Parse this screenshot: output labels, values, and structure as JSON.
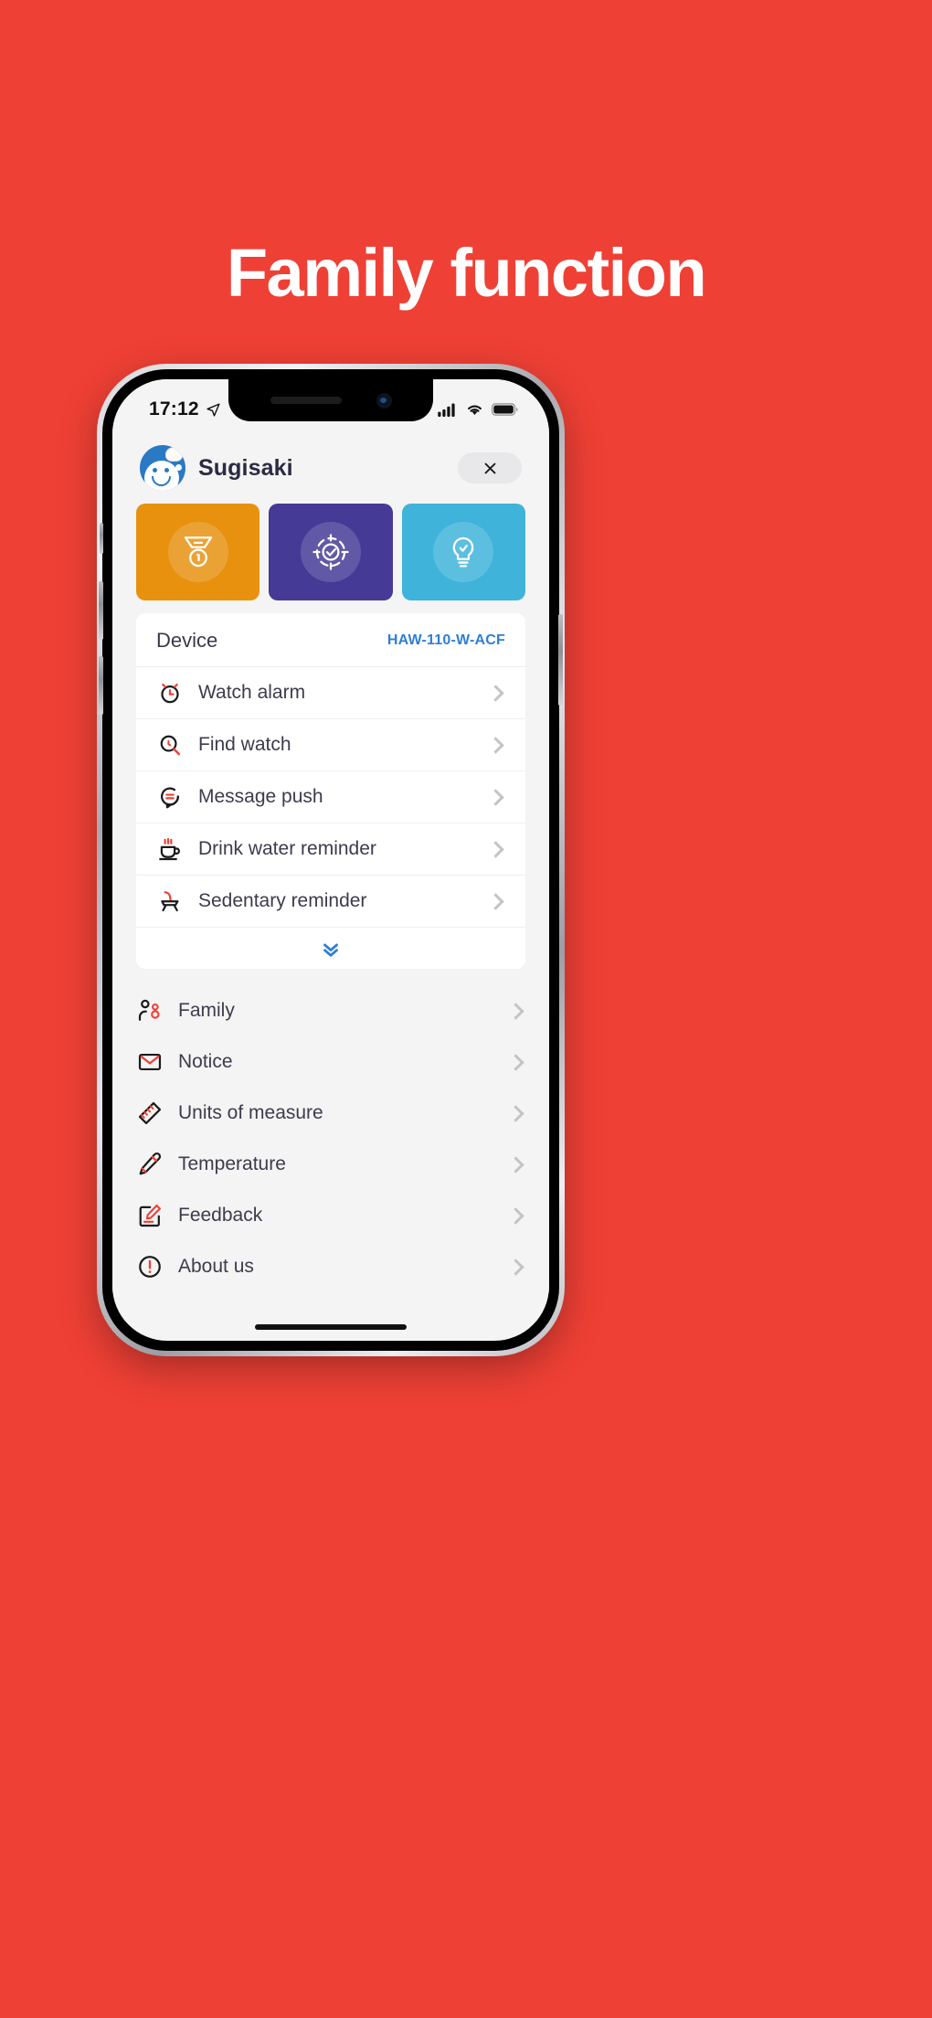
{
  "promo": {
    "headline": "Family function",
    "background_color": "#ef4035"
  },
  "status_bar": {
    "time": "17:12",
    "location_icon": "location-arrow-icon",
    "signal_icon": "cellular-signal-icon",
    "wifi_icon": "wifi-icon",
    "battery_icon": "battery-full-icon"
  },
  "header": {
    "avatar_icon": "user-avatar-icon",
    "title": "Sugisaki",
    "close_label": "close-icon"
  },
  "tiles": [
    {
      "name": "achievement",
      "icon": "medal-icon",
      "color": "#e8910f"
    },
    {
      "name": "goal",
      "icon": "target-check-icon",
      "color": "#453a96"
    },
    {
      "name": "tips",
      "icon": "lightbulb-check-icon",
      "color": "#3fb3d9"
    }
  ],
  "device_card": {
    "title": "Device",
    "value": "HAW-110-W-ACF",
    "value_color": "#2f7fd4",
    "items": [
      {
        "label": "Watch alarm",
        "icon": "alarm-clock-icon"
      },
      {
        "label": "Find watch",
        "icon": "search-watch-icon"
      },
      {
        "label": "Message push",
        "icon": "message-bubble-icon"
      },
      {
        "label": "Drink water reminder",
        "icon": "cup-icon"
      },
      {
        "label": "Sedentary reminder",
        "icon": "chair-icon"
      }
    ],
    "expand_icon": "double-chevron-down-icon"
  },
  "menu": {
    "items": [
      {
        "label": "Family",
        "icon": "family-people-icon"
      },
      {
        "label": "Notice",
        "icon": "envelope-icon"
      },
      {
        "label": "Units of measure",
        "icon": "ruler-icon"
      },
      {
        "label": "Temperature",
        "icon": "thermometer-icon"
      },
      {
        "label": "Feedback",
        "icon": "feedback-edit-icon"
      },
      {
        "label": "About us",
        "icon": "info-alert-icon"
      }
    ],
    "chevron_icon": "chevron-right-icon"
  }
}
